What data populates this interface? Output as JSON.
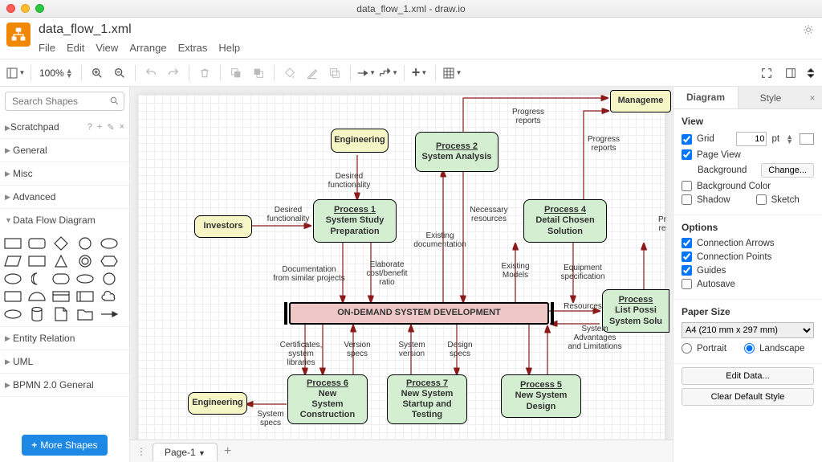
{
  "window_title": "data_flow_1.xml - draw.io",
  "file_name": "data_flow_1.xml",
  "menus": {
    "file": "File",
    "edit": "Edit",
    "view": "View",
    "arrange": "Arrange",
    "extras": "Extras",
    "help": "Help"
  },
  "zoom": "100%",
  "search_placeholder": "Search Shapes",
  "left": {
    "scratchpad": "Scratchpad",
    "general": "General",
    "misc": "Misc",
    "advanced": "Advanced",
    "dfd": "Data Flow Diagram",
    "entity": "Entity Relation",
    "uml": "UML",
    "bpmn": "BPMN 2.0 General",
    "more": "More Shapes"
  },
  "tab": "Page-1",
  "right": {
    "diagram": "Diagram",
    "style": "Style",
    "view": "View",
    "grid": "Grid",
    "grid_val": "10",
    "grid_unit": "pt",
    "pageview": "Page View",
    "background": "Background",
    "change": "Change...",
    "bgcolor": "Background Color",
    "shadow": "Shadow",
    "sketch": "Sketch",
    "options": "Options",
    "conn_arrows": "Connection Arrows",
    "conn_points": "Connection Points",
    "guides": "Guides",
    "autosave": "Autosave",
    "paper_size": "Paper Size",
    "paper_val": "A4 (210 mm x 297 mm)",
    "portrait": "Portrait",
    "landscape": "Landscape",
    "edit_data": "Edit Data...",
    "clear_style": "Clear Default Style"
  },
  "nodes": {
    "engineering1": "Engineering",
    "investors": "Investors",
    "p1_t": "Process 1",
    "p1": "System Study Preparation",
    "p2_t": "Process 2",
    "p2": "System Analysis",
    "p4_t": "Process 4",
    "p4": "Detail Chosen Solution",
    "center": "ON-DEMAND SYSTEM DEVELOPMENT",
    "management": "Manageme",
    "p3_t": "Process",
    "p3a": "List Possi",
    "p3b": "System Solu",
    "engineering2": "Engineering",
    "p6_t": "Process 6",
    "p6a": "New",
    "p6b": "System",
    "p6c": "Construction",
    "p7_t": "Process 7",
    "p7a": "New System",
    "p7b": "Startup and",
    "p7c": "Testing",
    "p5_t": "Process 5",
    "p5a": "New System",
    "p5b": "Design"
  },
  "labels": {
    "desired_func1": "Desired\nfunctionality",
    "desired_func2": "Desired\nfunctionality",
    "doc_similar": "Documentation\nfrom similar projects",
    "elaborate": "Elaborate\ncost/benefit\nratio",
    "existing_doc": "Existing\ndocumentation",
    "necessary": "Necessary\nresources",
    "progress1": "Progress\nreports",
    "progress2": "Progress\nreports",
    "existing_models": "Existing\nModels",
    "equipment": "Equipment\nspecification",
    "resources": "Resources",
    "sys_adv": "System\nAdvantages\nand Limitations",
    "pr_re": "Pr\nre",
    "certs": "Certificates,\nsystem\nlibraries",
    "version_specs": "Version\nspecs",
    "system_version": "System\nversion",
    "design_specs": "Design\nspecs",
    "system_specs": "System\nspecs"
  }
}
